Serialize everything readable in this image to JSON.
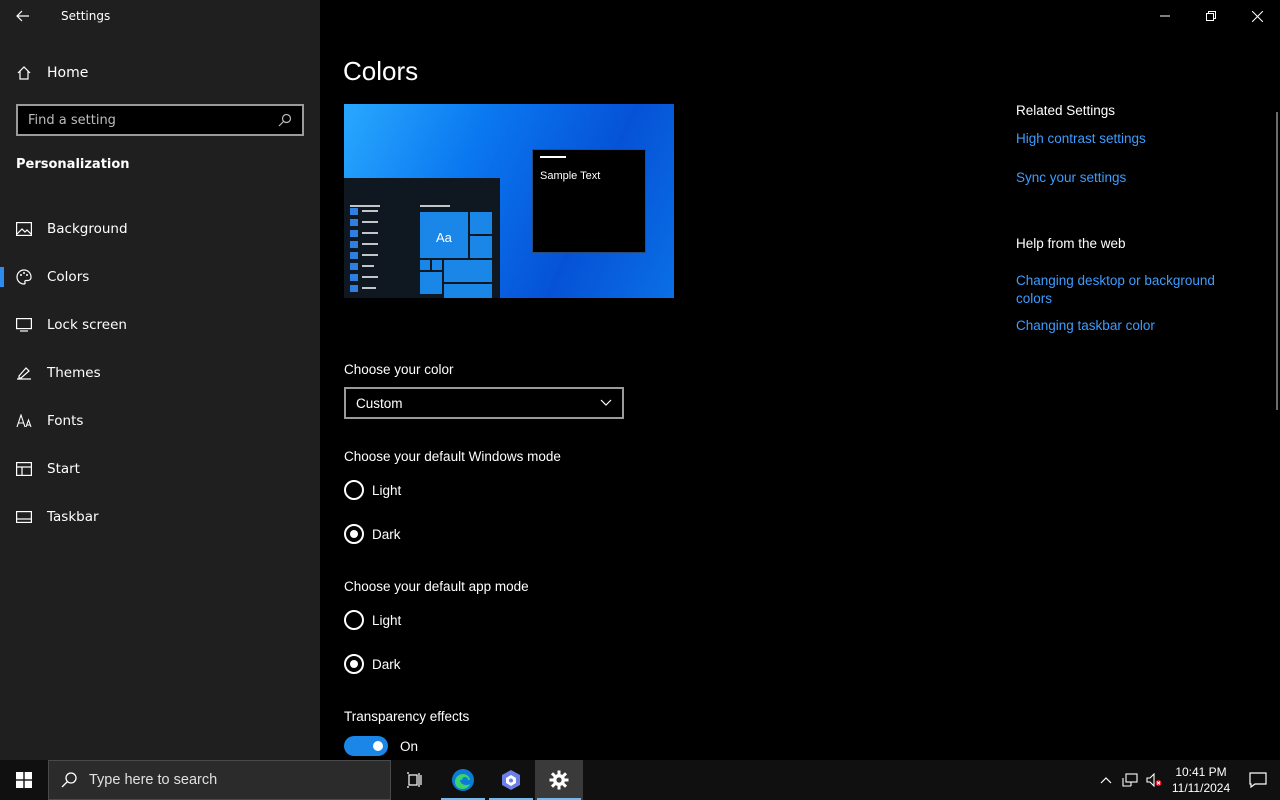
{
  "app": {
    "title": "Settings"
  },
  "sidebar": {
    "home_label": "Home",
    "search_placeholder": "Find a setting",
    "section_title": "Personalization",
    "items": [
      {
        "label": "Background",
        "icon": "image-icon"
      },
      {
        "label": "Colors",
        "icon": "palette-icon",
        "active": true
      },
      {
        "label": "Lock screen",
        "icon": "lock-screen-icon"
      },
      {
        "label": "Themes",
        "icon": "brush-icon"
      },
      {
        "label": "Fonts",
        "icon": "fonts-icon"
      },
      {
        "label": "Start",
        "icon": "start-icon"
      },
      {
        "label": "Taskbar",
        "icon": "taskbar-icon"
      }
    ]
  },
  "main": {
    "title": "Colors",
    "preview": {
      "sample_text": "Sample Text",
      "tile_text": "Aa"
    },
    "choose_color": {
      "label": "Choose your color",
      "value": "Custom"
    },
    "windows_mode": {
      "label": "Choose your default Windows mode",
      "options": [
        "Light",
        "Dark"
      ],
      "selected": "Dark"
    },
    "app_mode": {
      "label": "Choose your default app mode",
      "options": [
        "Light",
        "Dark"
      ],
      "selected": "Dark"
    },
    "transparency": {
      "label": "Transparency effects",
      "state": "On"
    }
  },
  "related": {
    "heading": "Related Settings",
    "links": [
      "High contrast settings",
      "Sync your settings"
    ],
    "help_heading": "Help from the web",
    "help_links": [
      "Changing desktop or background colors",
      "Changing taskbar color"
    ]
  },
  "taskbar": {
    "search_placeholder": "Type here to search",
    "time": "10:41 PM",
    "date": "11/11/2024"
  },
  "colors": {
    "accent": "#1a86e8",
    "link": "#3d9dff",
    "sidebar_bg": "#1f1f1f"
  }
}
